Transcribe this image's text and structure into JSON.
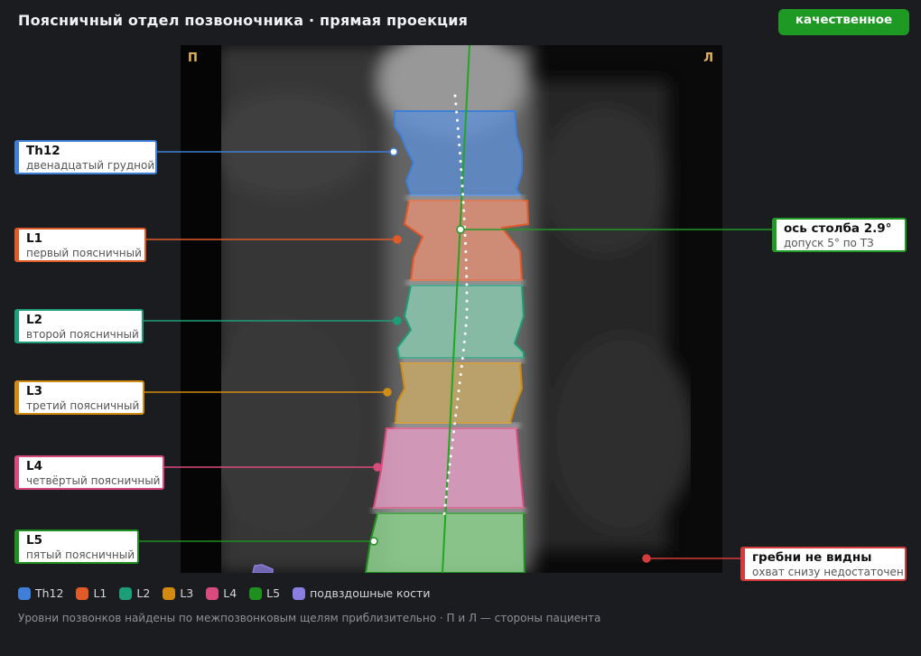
{
  "header": {
    "title": "Поясничный отдел позвоночника · прямая проекция",
    "badge": "качественное",
    "badge_color": "#1e9a24"
  },
  "scan": {
    "side_right_patient": "П",
    "side_left_patient": "Л"
  },
  "vertebrae": [
    {
      "id": "Th12",
      "name": "Th12",
      "description": "двенадцатый грудной",
      "color": "#3f7fd8"
    },
    {
      "id": "L1",
      "name": "L1",
      "description": "первый поясничный",
      "color": "#e05a2a"
    },
    {
      "id": "L2",
      "name": "L2",
      "description": "второй поясничный",
      "color": "#1e9e78"
    },
    {
      "id": "L3",
      "name": "L3",
      "description": "третий поясничный",
      "color": "#d18b12"
    },
    {
      "id": "L4",
      "name": "L4",
      "description": "четвёртый поясничный",
      "color": "#d94b7d"
    },
    {
      "id": "L5",
      "name": "L5",
      "description": "пятый поясничный",
      "color": "#1f8f1f"
    }
  ],
  "axis_callout": {
    "name": "ось столба 2.9°",
    "description": "допуск 5° по ТЗ",
    "color": "#1f9a24",
    "angle_deg": 2.9,
    "tolerance_deg": 5
  },
  "crest_callout": {
    "name": "гребни не видны",
    "description": "охват снизу недостаточен",
    "color": "#d63b3b"
  },
  "legend": [
    {
      "label": "Th12",
      "color": "#3f7fd8"
    },
    {
      "label": "L1",
      "color": "#e05a2a"
    },
    {
      "label": "L2",
      "color": "#1e9e78"
    },
    {
      "label": "L3",
      "color": "#d18b12"
    },
    {
      "label": "L4",
      "color": "#d94b7d"
    },
    {
      "label": "L5",
      "color": "#1f8f1f"
    },
    {
      "label": "подвздошные кости",
      "color": "#8a7ee0"
    }
  ],
  "footnote": "Уровни позвонков найдены по межпозвонковым щелям приблизительно · П и Л — стороны пациента"
}
